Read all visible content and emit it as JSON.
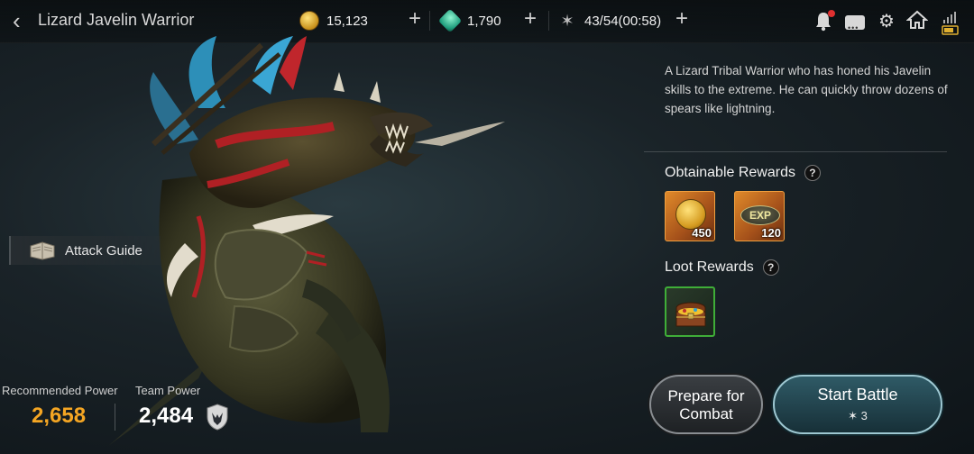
{
  "header": {
    "title": "Lizard Javelin Warrior",
    "gold": "15,123",
    "gems": "1,790",
    "stamina": "43/54(00:58)"
  },
  "icons": {
    "back": "chevron-left-icon",
    "gold": "gold-coin-icon",
    "gems": "green-gem-icon",
    "stamina": "stamina-feather-icon",
    "notification": "bell-icon",
    "chat": "chat-icon",
    "settings": "gear-icon",
    "home": "home-icon"
  },
  "attack_guide": {
    "label": "Attack Guide"
  },
  "power": {
    "recommended_label": "Recommended Power",
    "recommended_value": "2,658",
    "team_label": "Team Power",
    "team_value": "2,484"
  },
  "details": {
    "description": "A Lizard Tribal Warrior who has honed his Javelin skills to the extreme. He can quickly throw dozens of spears like lightning.",
    "obtainable_title": "Obtainable Rewards",
    "obtainable": [
      {
        "icon": "gold-coin",
        "qty": "450"
      },
      {
        "icon": "exp",
        "label": "EXP",
        "qty": "120"
      }
    ],
    "loot_title": "Loot Rewards",
    "loot": [
      {
        "icon": "treasure-chest"
      }
    ],
    "help_glyph": "?"
  },
  "buttons": {
    "prepare_line1": "Prepare for",
    "prepare_line2": "Combat",
    "start_label": "Start Battle",
    "start_cost": "3"
  },
  "colors": {
    "recommended": "#f5a623",
    "accent_start": "#2f5a66",
    "loot_border": "#3fae38"
  }
}
